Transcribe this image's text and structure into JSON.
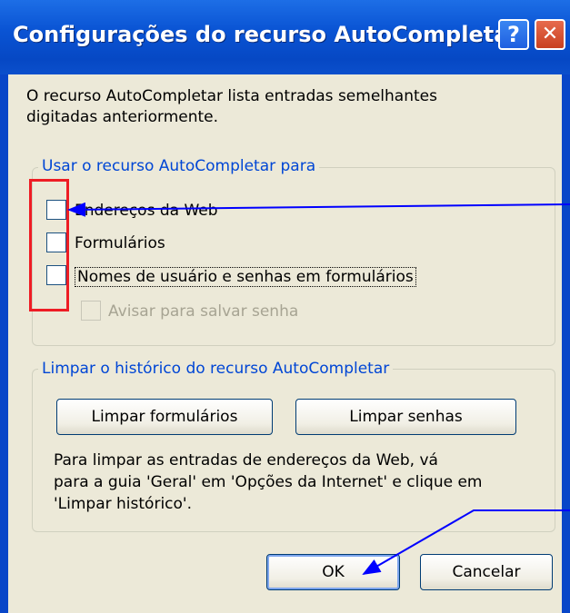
{
  "window": {
    "title": "Configurações do recurso AutoCompletar"
  },
  "titlebar_buttons": {
    "help_glyph": "?",
    "close_glyph": "✕"
  },
  "description": {
    "line1": "O recurso AutoCompletar lista entradas semelhantes",
    "line2": "digitadas anteriormente."
  },
  "usage_group": {
    "legend": "Usar o recurso AutoCompletar para",
    "options": [
      {
        "label": "Endereços da Web",
        "checked": false
      },
      {
        "label": "Formulários",
        "checked": false
      },
      {
        "label": "Nomes de usuário e senhas em formulários",
        "checked": false
      },
      {
        "label": "Avisar para salvar senha",
        "checked": false,
        "enabled": false
      }
    ]
  },
  "clear_group": {
    "legend": "Limpar o histórico do recurso AutoCompletar",
    "buttons": {
      "clear_forms": "Limpar formulários",
      "clear_passwords": "Limpar senhas"
    },
    "note": {
      "line1": "Para limpar as entradas de endereços da Web, vá",
      "line2": "para a guia 'Geral' em 'Opções da Internet' e clique em",
      "line3": "'Limpar histórico'."
    }
  },
  "footer_buttons": {
    "ok": "OK",
    "cancel": "Cancelar"
  },
  "annotations": {
    "highlight_color": "#ee1c24",
    "arrow_color": "#0000ff"
  },
  "colors": {
    "titlebar": "#0a54d4",
    "group_legend": "#0046d5",
    "dialog_bg": "#ece9d8"
  }
}
